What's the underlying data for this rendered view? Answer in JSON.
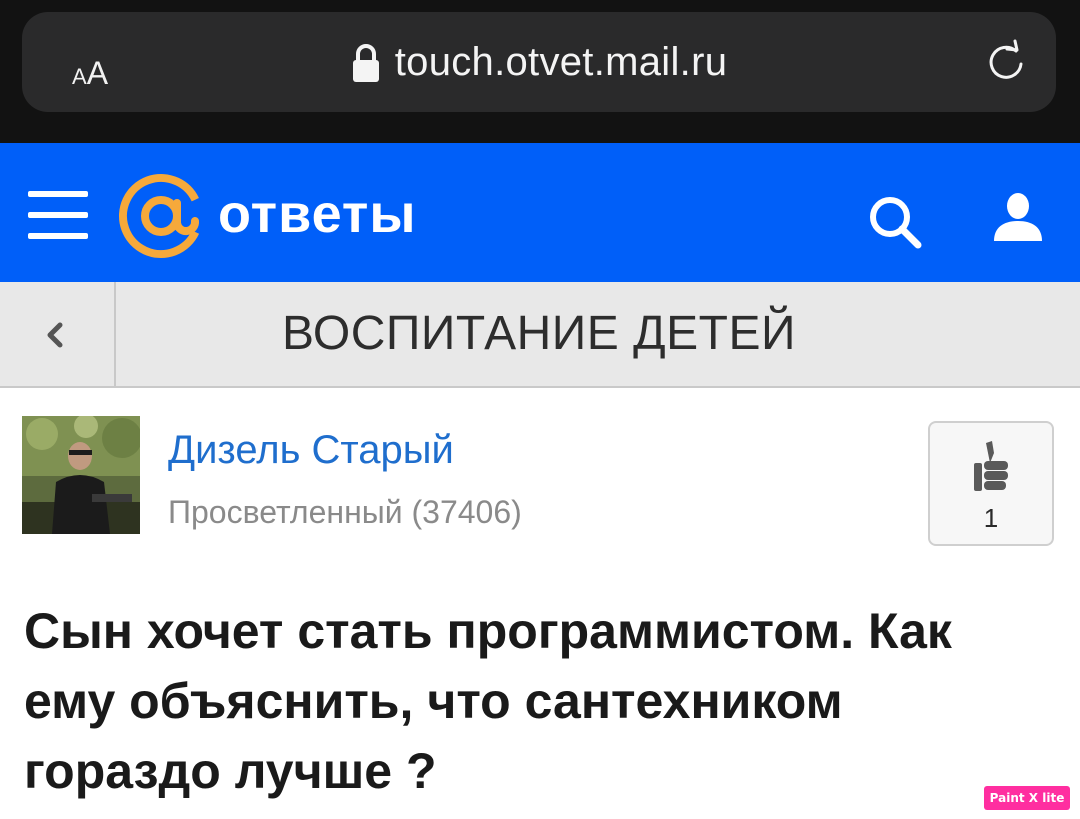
{
  "browser": {
    "text_size_small": "A",
    "text_size_large": "A",
    "url": "touch.otvet.mail.ru",
    "lock_icon": "lock-icon",
    "reload_icon": "reload-icon"
  },
  "header": {
    "logo_symbol": "@",
    "logo_text": "ответы",
    "background_color": "#005ff9",
    "logo_color": "#f6a93b",
    "menu_icon": "hamburger-menu-icon",
    "search_icon": "search-icon",
    "user_icon": "user-icon"
  },
  "category": {
    "back_icon": "chevron-left-icon",
    "title": "ВОСПИТАНИЕ ДЕТЕЙ"
  },
  "question": {
    "author": {
      "name": "Дизель Старый",
      "rank": "Просветленный (37406)",
      "avatar": "author-avatar-photo"
    },
    "likes": {
      "icon": "thumbs-up-icon",
      "count": "1"
    },
    "title": "Сын хочет стать программистом. Как ему объяснить, что сантехником гораздо лучше ?"
  },
  "watermark": {
    "text": "Paint X lite",
    "color": "#ff2ea0"
  }
}
